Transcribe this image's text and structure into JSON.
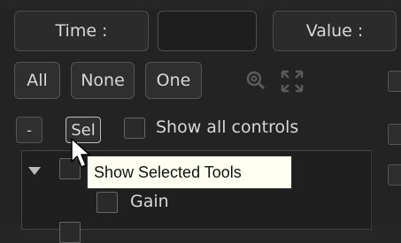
{
  "header": {
    "time_label": "Time :",
    "value_label": "Value :"
  },
  "filters": {
    "all": "All",
    "none": "None",
    "one": "One"
  },
  "controls": {
    "minus": "-",
    "sel": "Sel",
    "show_all_controls": "Show all controls"
  },
  "tree": {
    "items": [
      {
        "label": ""
      },
      {
        "label": "Gain"
      }
    ]
  },
  "tooltip": "Show Selected Tools",
  "icons": {
    "zoom": "zoom-icon",
    "fit": "fit-view-icon",
    "expand": "expand-triangle-icon"
  }
}
